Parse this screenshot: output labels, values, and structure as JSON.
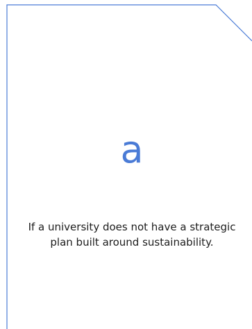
{
  "card": {
    "letter": "a",
    "text": "If a university does not have a strategic plan built around sustainability.",
    "border_color": "#4a7bd6",
    "letter_color": "#4a7bd6",
    "text_color": "#1c1c1c"
  }
}
